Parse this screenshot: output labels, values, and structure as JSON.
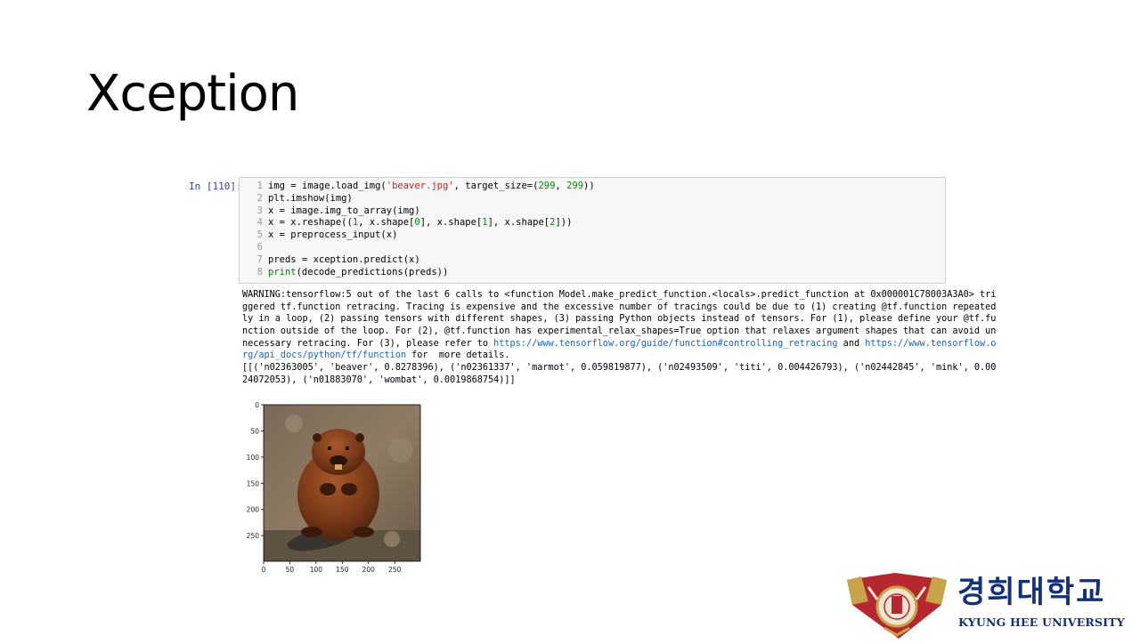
{
  "slide": {
    "title": "Xception"
  },
  "cell": {
    "prompt": "In [110]:",
    "line_numbers": [
      "1",
      "2",
      "3",
      "4",
      "5",
      "6",
      "7",
      "8"
    ],
    "code_lines": [
      [
        {
          "t": "img = image.load_img("
        },
        {
          "t": "'beaver.jpg'",
          "c": "str"
        },
        {
          "t": ", target_size=("
        },
        {
          "t": "299",
          "c": "num"
        },
        {
          "t": ", "
        },
        {
          "t": "299",
          "c": "num"
        },
        {
          "t": "))"
        }
      ],
      [
        {
          "t": "plt.imshow(img)"
        }
      ],
      [
        {
          "t": "x = image.img_to_array(img)"
        }
      ],
      [
        {
          "t": "x = x.reshape(("
        },
        {
          "t": "1",
          "c": "num"
        },
        {
          "t": ", x.shape["
        },
        {
          "t": "0",
          "c": "num"
        },
        {
          "t": "], x.shape["
        },
        {
          "t": "1",
          "c": "num"
        },
        {
          "t": "], x.shape["
        },
        {
          "t": "2",
          "c": "num"
        },
        {
          "t": "]))"
        }
      ],
      [
        {
          "t": "x = preprocess_input(x)"
        }
      ],
      [
        {
          "t": ""
        }
      ],
      [
        {
          "t": "preds = xception.predict(x)"
        }
      ],
      [
        {
          "t": "print",
          "c": "kw"
        },
        {
          "t": "(decode_predictions(preds))"
        }
      ]
    ]
  },
  "output": {
    "lines": [
      [
        {
          "t": "WARNING:tensorflow:5 out of the last 6 calls to <function Model.make_predict_function.<locals>.predict_function at 0x000001C78003A3A0> tri"
        }
      ],
      [
        {
          "t": "ggered tf.function retracing. Tracing is expensive and the excessive number of tracings could be due to (1) creating @tf.function repeated"
        }
      ],
      [
        {
          "t": "ly in a loop, (2) passing tensors with different shapes, (3) passing Python objects instead of tensors. For (1), please define your @tf.fu"
        }
      ],
      [
        {
          "t": "nction outside of the loop. For (2), @tf.function has experimental_relax_shapes=True option that relaxes argument shapes that can avoid un"
        }
      ],
      [
        {
          "t": "necessary retracing. For (3), please refer to "
        },
        {
          "t": "https://www.tensorflow.org/guide/function#controlling_retracing",
          "c": "link"
        },
        {
          "t": " and "
        },
        {
          "t": "https://www.tensorflow.o",
          "c": "link"
        }
      ],
      [
        {
          "t": "rg/api_docs/python/tf/function",
          "c": "link"
        },
        {
          "t": " for  more details."
        }
      ],
      [
        {
          "t": "[[('n02363005', 'beaver', 0.8278396), ('n02361337', 'marmot', 0.059819877), ('n02493509', 'titi', 0.004426793), ('n02442845', 'mink', 0.00"
        }
      ],
      [
        {
          "t": "24072053), ('n01883070', 'wombat', 0.0019868754)]]"
        }
      ]
    ]
  },
  "plot": {
    "y_ticks": [
      "0",
      "50",
      "100",
      "150",
      "200",
      "250"
    ],
    "x_ticks": [
      "0",
      "50",
      "100",
      "150",
      "200",
      "250"
    ],
    "image_subject": "beaver photo"
  },
  "logo": {
    "korean": "경희대학교",
    "english": "KYUNG HEE UNIVERSITY",
    "colors": {
      "emblem_red": "#b5282f",
      "emblem_gold": "#c9a34a",
      "text_blue": "#12317a"
    }
  }
}
